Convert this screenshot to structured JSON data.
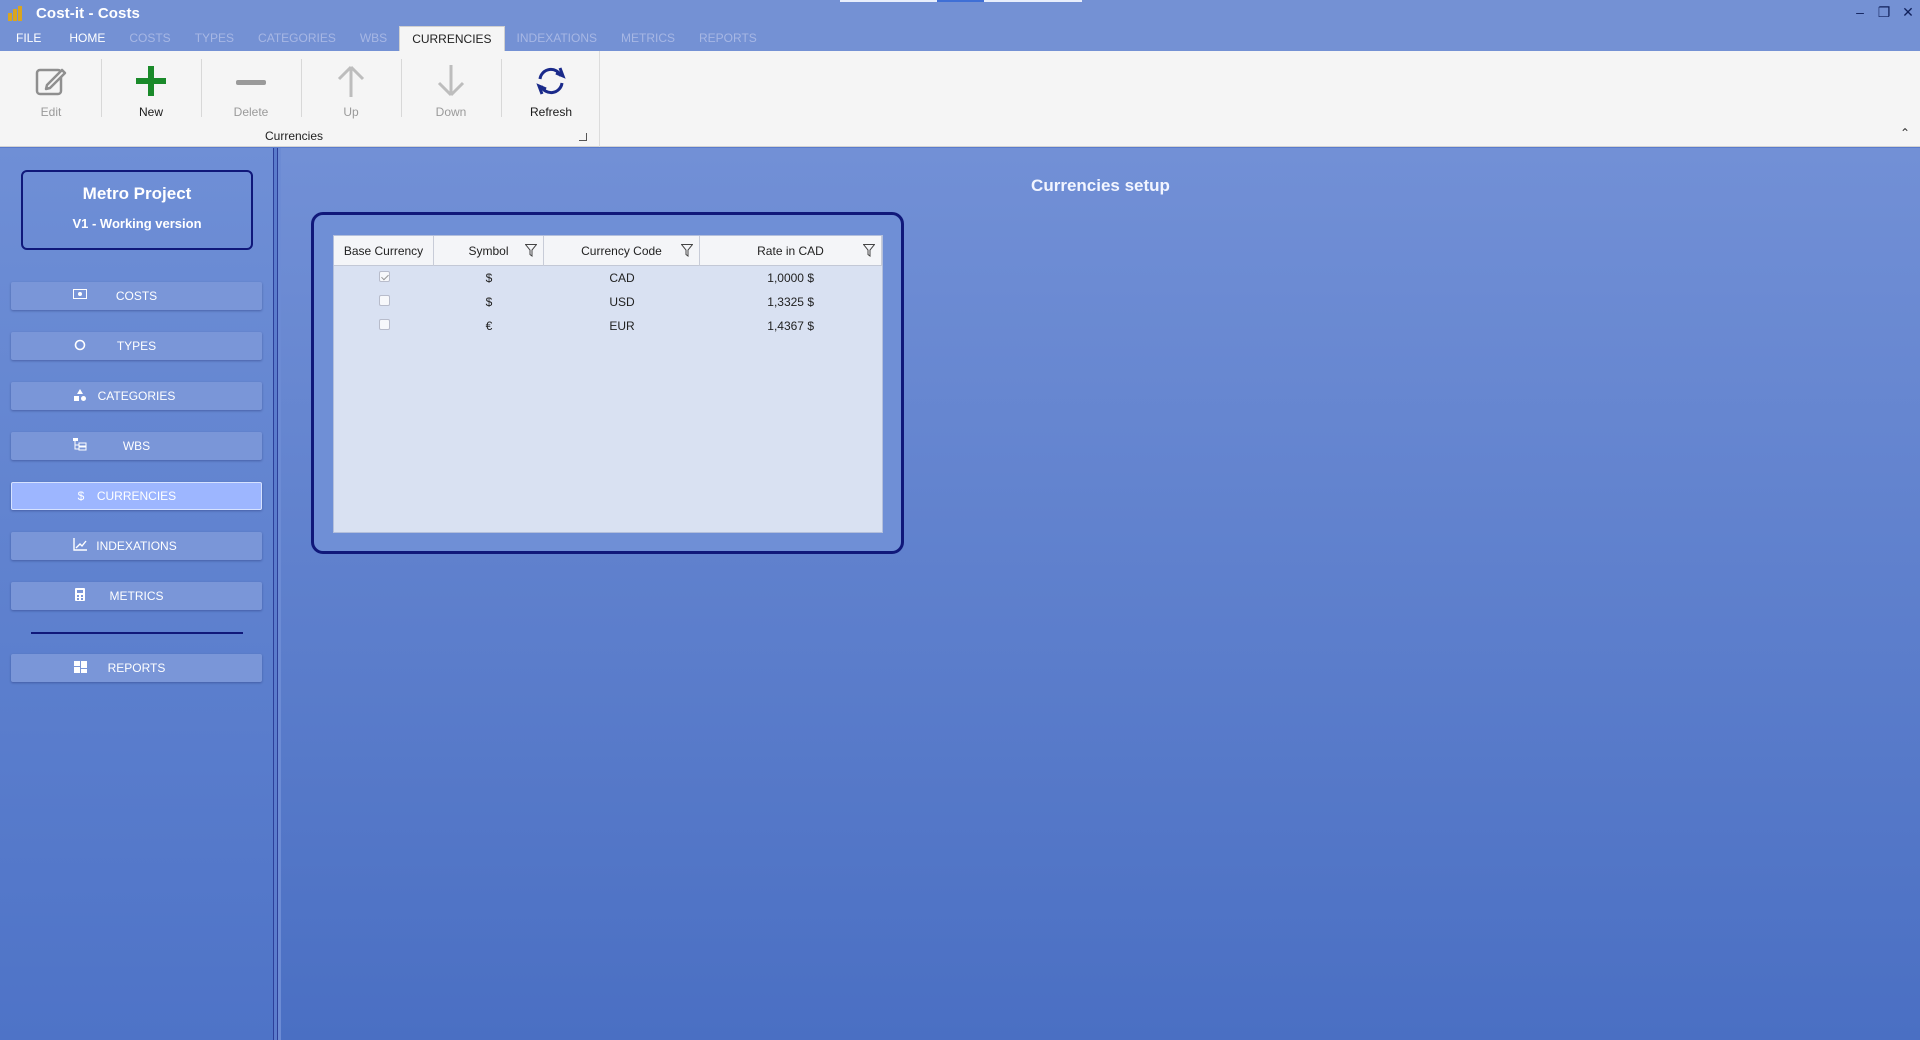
{
  "window": {
    "title": "Cost-it - Costs"
  },
  "ribbon": {
    "tabs": [
      {
        "label": "FILE",
        "state": "normal"
      },
      {
        "label": "HOME",
        "state": "normal"
      },
      {
        "label": "COSTS",
        "state": "disabled"
      },
      {
        "label": "TYPES",
        "state": "disabled"
      },
      {
        "label": "CATEGORIES",
        "state": "disabled"
      },
      {
        "label": "WBS",
        "state": "disabled"
      },
      {
        "label": "CURRENCIES",
        "state": "active"
      },
      {
        "label": "INDEXATIONS",
        "state": "disabled"
      },
      {
        "label": "METRICS",
        "state": "disabled"
      },
      {
        "label": "REPORTS",
        "state": "disabled"
      }
    ],
    "buttons": {
      "edit": "Edit",
      "new": "New",
      "delete": "Delete",
      "up": "Up",
      "down": "Down",
      "refresh": "Refresh"
    },
    "group_label": "Currencies"
  },
  "project": {
    "name": "Metro Project",
    "version": "V1 - Working version"
  },
  "nav": {
    "costs": "COSTS",
    "types": "TYPES",
    "categories": "CATEGORIES",
    "wbs": "WBS",
    "currencies": "CURRENCIES",
    "indexations": "INDEXATIONS",
    "metrics": "METRICS",
    "reports": "REPORTS",
    "active": "currencies"
  },
  "main": {
    "title": "Currencies setup",
    "grid": {
      "headers": {
        "base": "Base Currency",
        "symbol": "Symbol",
        "code": "Currency Code",
        "rate": "Rate in CAD"
      },
      "rows": [
        {
          "base": true,
          "symbol": "$",
          "code": "CAD",
          "rate": "1,0000 $"
        },
        {
          "base": false,
          "symbol": "$",
          "code": "USD",
          "rate": "1,3325 $"
        },
        {
          "base": false,
          "symbol": "€",
          "code": "EUR",
          "rate": "1,4367 $"
        }
      ]
    }
  },
  "colors": {
    "accent_green": "#1a8a2a",
    "refresh_blue": "#1a2a8a",
    "panel_border": "#10187a",
    "active_nav": "#9db6ff"
  }
}
